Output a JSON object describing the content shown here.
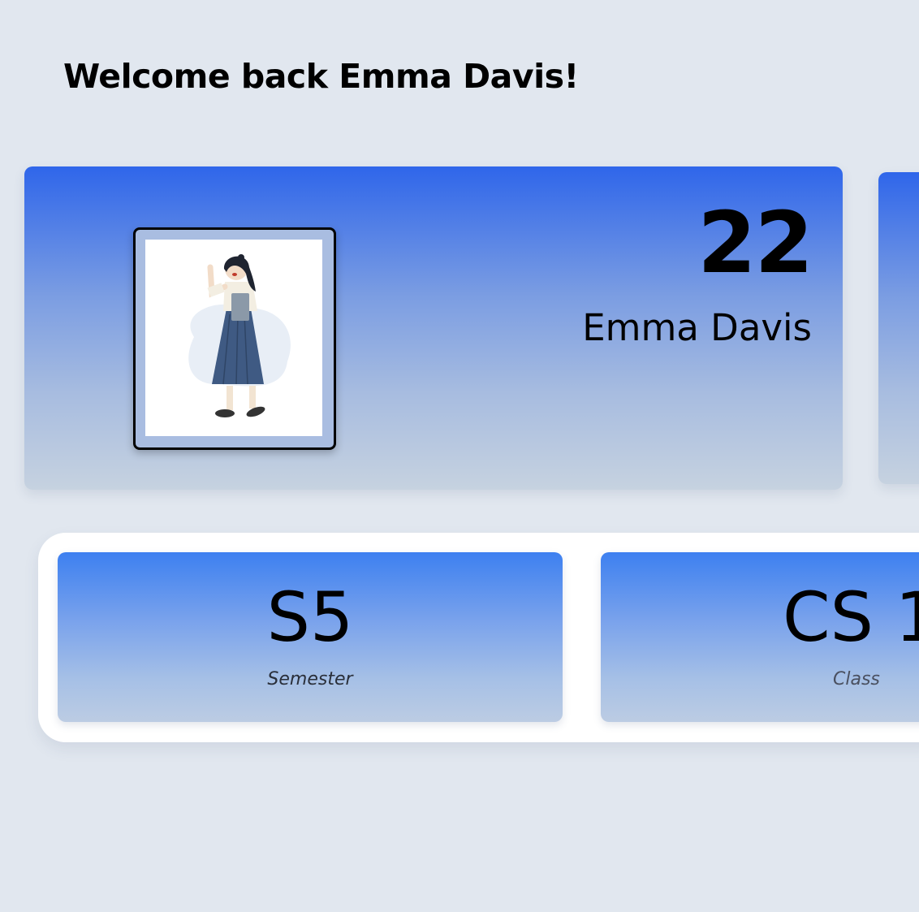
{
  "header": {
    "welcome_text": "Welcome back Emma Davis!"
  },
  "profile": {
    "age": "22",
    "name": "Emma Davis",
    "avatar_icon": "student-girl-illustration"
  },
  "stats": {
    "semester": {
      "value": "S5",
      "label": "Semester"
    },
    "class": {
      "value": "CS 1",
      "label": "Class"
    }
  },
  "colors": {
    "background": "#e1e7ef",
    "card_gradient_top": "#2f66ea",
    "card_gradient_bottom": "#c6d2e0",
    "stat_gradient_top": "#3d80f0"
  }
}
